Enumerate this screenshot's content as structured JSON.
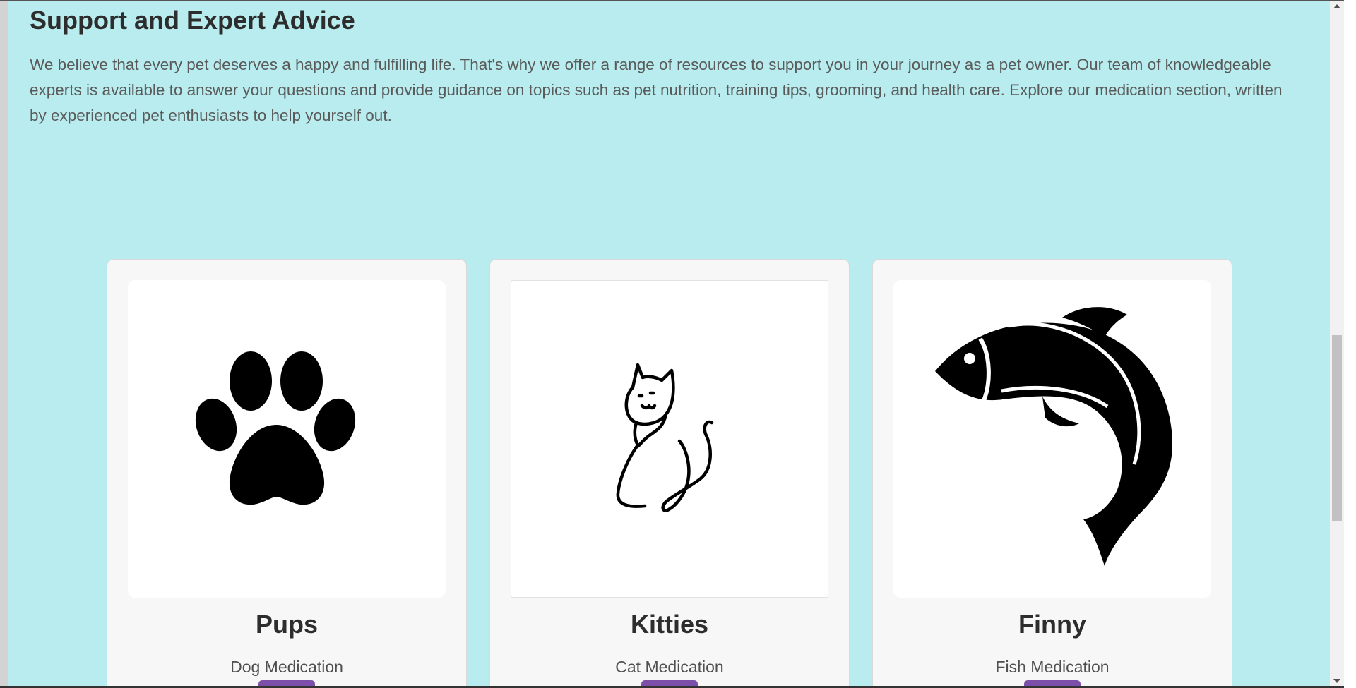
{
  "section": {
    "title": "Support and Expert Advice",
    "intro": "We believe that every pet deserves a happy and fulfilling life. That's why we offer a range of resources to support you in your journey as a pet owner. Our team of knowledgeable experts is available to answer your questions and provide guidance on topics such as pet nutrition, training tips, grooming, and health care. Explore our medication section, written by experienced pet enthusiasts to help yourself out."
  },
  "cards": [
    {
      "name": "Pups",
      "subtitle": "Dog Medication",
      "icon": "paw-icon"
    },
    {
      "name": "Kitties",
      "subtitle": "Cat Medication",
      "icon": "cat-icon"
    },
    {
      "name": "Finny",
      "subtitle": "Fish Medication",
      "icon": "fish-icon"
    }
  ],
  "colors": {
    "background": "#b8ecee",
    "card": "#f7f7f7",
    "button": "#7c4fa8",
    "heading": "#2d2d2d",
    "body_text": "#5a5a5a"
  }
}
